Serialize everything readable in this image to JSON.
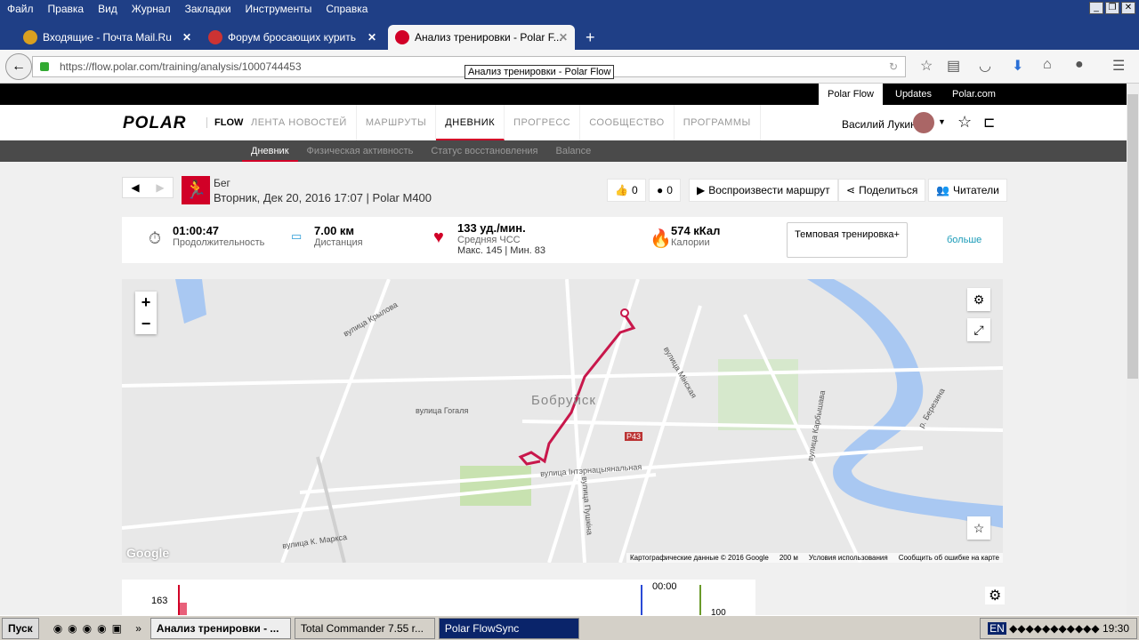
{
  "browser": {
    "menu": [
      "Файл",
      "Правка",
      "Вид",
      "Журнал",
      "Закладки",
      "Инструменты",
      "Справка"
    ],
    "tabs": [
      {
        "title": "Входящие - Почта Mail.Ru"
      },
      {
        "title": "Форум бросающих курить"
      },
      {
        "title": "Анализ тренировки - Polar F..."
      }
    ],
    "url": "https://flow.polar.com/training/analysis/1000744453",
    "tooltip": "Анализ тренировки - Polar Flow"
  },
  "topbar": [
    "Polar Flow",
    "Updates",
    "Polar.com"
  ],
  "header": {
    "logo": "POLAR",
    "flow": "FLOW",
    "nav": [
      "ЛЕНТА НОВОСТЕЙ",
      "МАРШРУТЫ",
      "ДНЕВНИК",
      "ПРОГРЕСС",
      "СООБЩЕСТВО",
      "ПРОГРАММЫ"
    ],
    "user": "Василий Лукин"
  },
  "subnav": [
    "Дневник",
    "Физическая активность",
    "Статус восстановления",
    "Balance"
  ],
  "session": {
    "sport": "Бег",
    "subtitle": "Вторник, Дек 20, 2016 17:07 | Polar M400",
    "likes": "0",
    "comments": "0",
    "replay": "Воспроизвести маршрут",
    "share": "Поделиться",
    "followers": "Читатели"
  },
  "summary": {
    "duration": "01:00:47",
    "duration_label": "Продолжительность",
    "distance": "7.00 км",
    "distance_label": "Дистанция",
    "hr": "133 уд./мин.",
    "hr_label": "Средняя ЧСС",
    "hr_minmax": "Макс. 145 | Мин. 83",
    "calories": "574 кКал",
    "calories_label": "Калории",
    "tempo": "Темповая тренировка+",
    "more": "больше"
  },
  "map": {
    "city": "Бобруйск",
    "labels": [
      "вулица Гогаля",
      "вулица Мінская",
      "вулица Інтэрнацыянальная",
      "вулица К. Маркса",
      "вулица Пушкіна",
      "вулица Карбышава",
      "р. Березина",
      "вулица Крылова",
      "P43"
    ],
    "google": "Google",
    "attribution": [
      "Картографические данные © 2016 Google",
      "200 м",
      "Условия использования",
      "Сообщить об ошибке на карте"
    ]
  },
  "chart": {
    "y_tick": "163",
    "time": "00:00",
    "y2": "100"
  },
  "taskbar": {
    "start": "Пуск",
    "tasks": [
      "Анализ тренировки - ...",
      "Total Commander 7.55 r...",
      "Polar FlowSync"
    ],
    "lang": "EN",
    "clock": "19:30"
  }
}
